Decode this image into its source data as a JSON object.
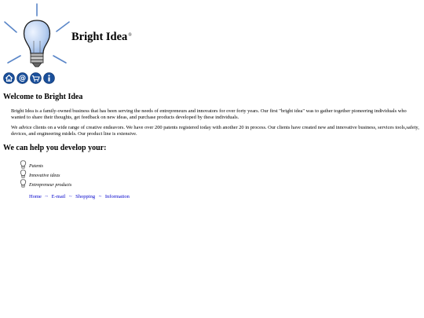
{
  "header": {
    "brand_name": "Bright Idea",
    "brand_mark": "®",
    "logo_icon": "lightbulb-icon"
  },
  "icon_bar": [
    {
      "name": "home-icon"
    },
    {
      "name": "email-at-icon"
    },
    {
      "name": "shopping-cart-icon"
    },
    {
      "name": "info-icon"
    }
  ],
  "colors": {
    "accent": "#1a4f9a",
    "link": "#0000cc",
    "bulb_glass": "#b8cff0"
  },
  "main": {
    "welcome_heading": "Welcome to Bright Idea",
    "paragraph_1": "Bright Idea is a family-owned business that has been serving the needs of entrepreneurs and innovators for over forty years. Our first \"bright idea\" was to gather together pioneering individuals who wanted to share their thoughts, get feedback on new ideas, and purchase products developed by these individuals.",
    "paragraph_2": "We advice clients on a wide range of creative endeavors. We have over 200 patents registered today with another 20 in process. Our clients have created new and innovative business, services tools,safety, devices, and engineering midels. Our product line is extensive.",
    "help_heading": "We can help you develop your:",
    "services": [
      "Patents",
      "Innovative ideas",
      "Entrepreneur products"
    ]
  },
  "footer_nav": {
    "links": [
      "Home",
      "E-mail",
      "Shopping",
      "Information"
    ],
    "separator": "~"
  }
}
